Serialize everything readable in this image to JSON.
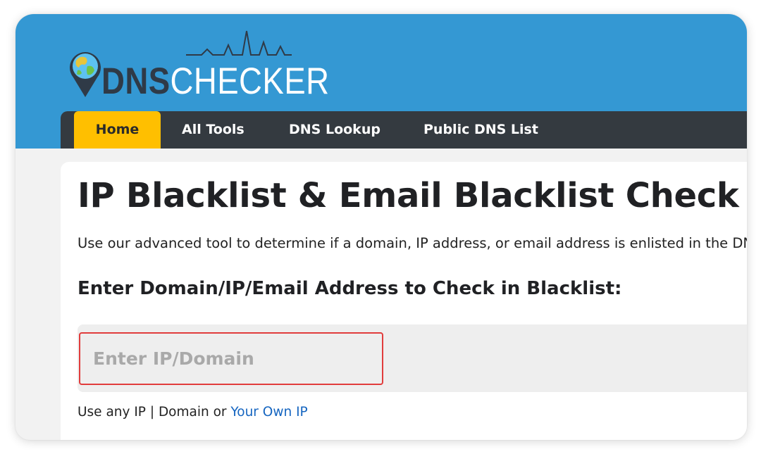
{
  "brand": {
    "logo_part1": "DNS",
    "logo_part2": "CHECKER",
    "header_color": "#3498d3",
    "nav_color": "#343a40",
    "accent_color": "#ffbf00"
  },
  "nav": {
    "items": [
      {
        "label": "Home",
        "active": true
      },
      {
        "label": "All Tools",
        "active": false
      },
      {
        "label": "DNS Lookup",
        "active": false
      },
      {
        "label": "Public DNS List",
        "active": false
      }
    ]
  },
  "main": {
    "title": "IP Blacklist & Email Blacklist Check",
    "description": "Use our advanced tool to determine if a domain, IP address, or email address is enlisted in the DNSBL",
    "input_label": "Enter Domain/IP/Email Address to Check in Blacklist:",
    "input_placeholder": "Enter IP/Domain",
    "input_value": "",
    "highlight_color": "#e13c3c",
    "hint_prefix": "Use any IP | Domain or ",
    "hint_link": "Your Own IP"
  }
}
